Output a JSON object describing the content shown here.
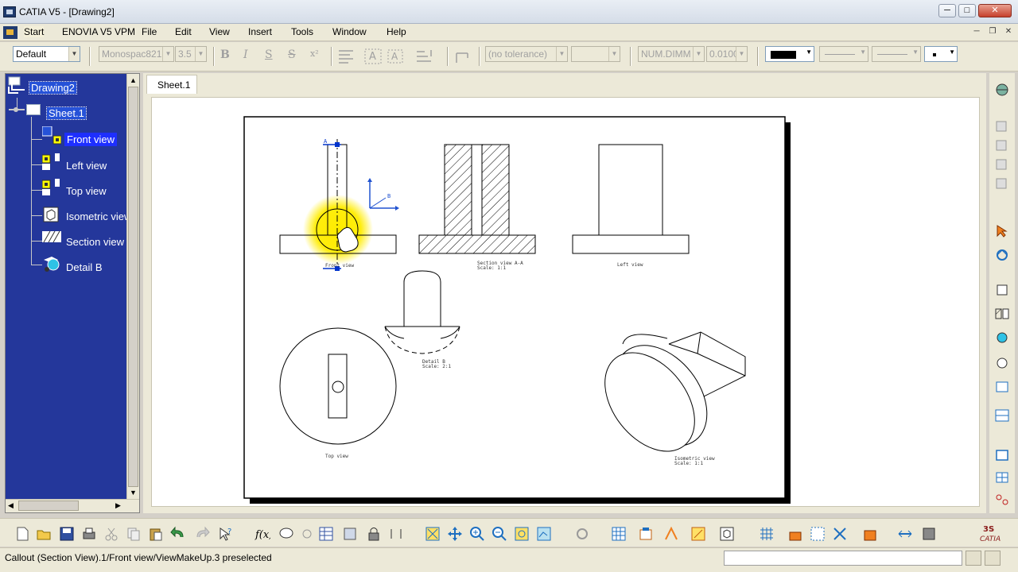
{
  "window": {
    "title": "CATIA V5 - [Drawing2]",
    "min": "─",
    "max": "□",
    "close": "✕"
  },
  "menu": {
    "start": "Start",
    "items": [
      "ENOVIA V5 VPM",
      "File",
      "Edit",
      "View",
      "Insert",
      "Tools",
      "Window",
      "Help"
    ]
  },
  "toolbar": {
    "style": "Default",
    "font": "Monospac821",
    "font_size": "3.5",
    "bold": "B",
    "italic": "I",
    "underline": "S",
    "strike": "S",
    "superscript": "x²",
    "tolerance": "(no tolerance)",
    "tolerance2": "",
    "num_dimm": "NUM.DIMM",
    "precision": "0.0100"
  },
  "tree": {
    "root": "Drawing2",
    "sheet": "Sheet.1",
    "views": [
      "Front view",
      "Left view",
      "Top view",
      "Isometric view",
      "Section view",
      "Detail B"
    ]
  },
  "tabs": {
    "sheet": "Sheet.1"
  },
  "drawing": {
    "front_label": "Front view",
    "section_label": "Section view A-A",
    "section_scale": "Scale:  1:1",
    "left_label": "Left view",
    "detail_label": "Detail B",
    "detail_scale": "Scale:  2:1",
    "top_label": "Top view",
    "iso_label": "Isometric view",
    "iso_scale": "Scale:  1:1",
    "axis_a": "A",
    "axis_b": "B"
  },
  "status": {
    "message": "Callout (Section View).1/Front view/ViewMakeUp.3 preselected"
  },
  "colors": {
    "tree_bg": "#24379b",
    "chrome": "#ece9d8",
    "highlight": "#ffeb3b"
  }
}
